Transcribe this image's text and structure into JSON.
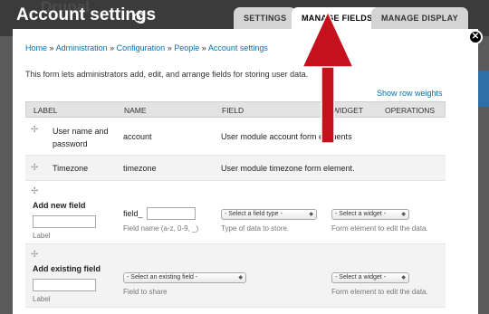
{
  "header": {
    "title": "Account settings",
    "watermark": "Drupal",
    "tabs": [
      "SETTINGS",
      "MANAGE FIELDS",
      "MANAGE DISPLAY"
    ],
    "active_tab": "MANAGE FIELDS"
  },
  "breadcrumb": [
    "Home",
    "Administration",
    "Configuration",
    "People",
    "Account settings"
  ],
  "breadcrumb_separator": "»",
  "intro": "This form lets administrators add, edit, and arrange fields for storing user data.",
  "row_weights_link": "Show row weights",
  "table": {
    "headers": [
      "LABEL",
      "NAME",
      "FIELD",
      "WIDGET",
      "OPERATIONS"
    ],
    "rows": [
      {
        "label_line1": "User name and",
        "label_line2": "password",
        "name": "account",
        "field": "User module account form elements"
      },
      {
        "label": "Timezone",
        "name": "timezone",
        "field": "User module timezone form element."
      }
    ],
    "add_new": {
      "title": "Add new field",
      "label_caption": "Label",
      "name_prefix": "field_",
      "name_help": "Field name (a-z, 0-9, _)",
      "type_select": "- Select a field type -",
      "type_help": "Type of data to store.",
      "widget_select": "- Select a widget -",
      "widget_help": "Form element to edit the data."
    },
    "add_existing": {
      "title": "Add existing field",
      "label_caption": "Label",
      "field_select": "- Select an existing field -",
      "field_help": "Field to share",
      "widget_select": "- Select a widget -",
      "widget_help": "Form element to edit the data."
    }
  },
  "colors": {
    "link": "#0071b3",
    "annotation_arrow": "#c4111b",
    "header_bg": "#3b3b3b"
  }
}
